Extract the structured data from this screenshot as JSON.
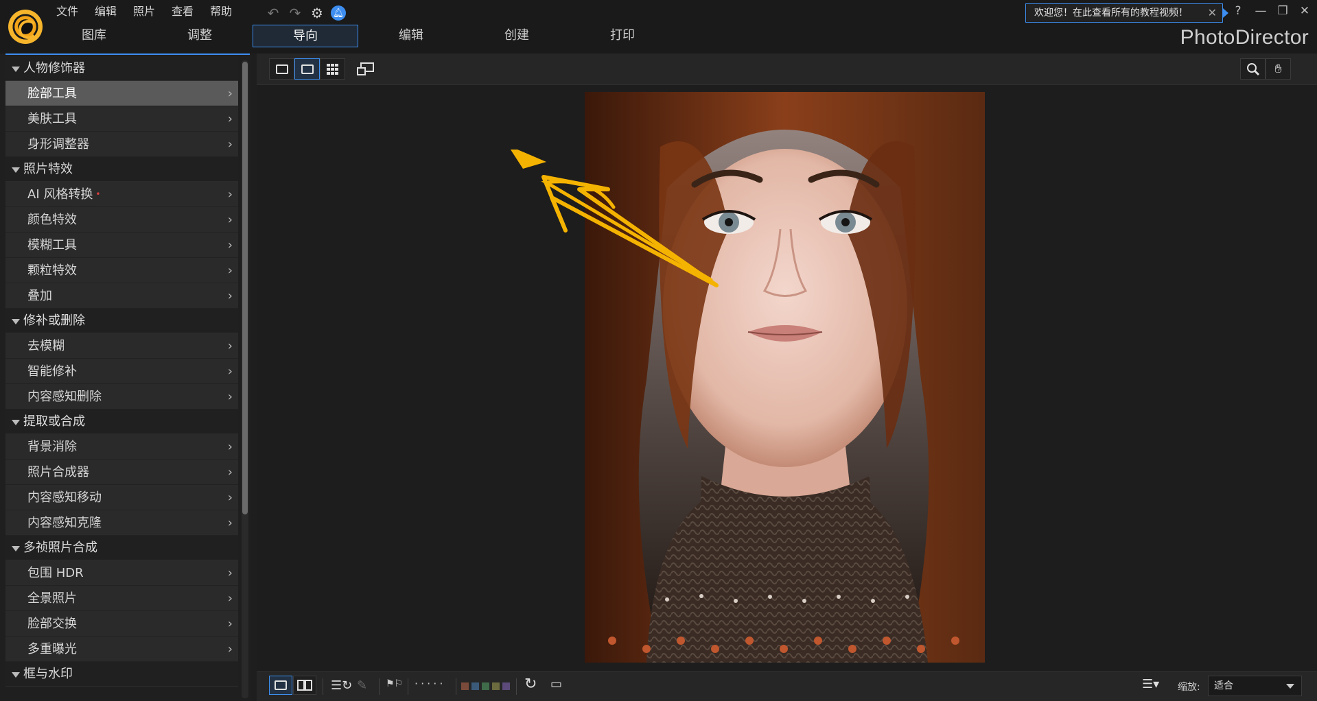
{
  "menu": [
    "文件",
    "编辑",
    "照片",
    "查看",
    "帮助"
  ],
  "tabs": [
    "图库",
    "调整",
    "导向",
    "编辑",
    "创建",
    "打印"
  ],
  "active_tab": "导向",
  "welcome": "欢迎您！在此查看所有的教程视频！",
  "brand": "PhotoDirector",
  "window_help": "?",
  "tree": [
    {
      "label": "人物修饰器",
      "items": [
        {
          "label": "脸部工具",
          "selected": true
        },
        {
          "label": "美肤工具"
        },
        {
          "label": "身形调整器"
        }
      ]
    },
    {
      "label": "照片特效",
      "items": [
        {
          "label": "AI 风格转换",
          "dot": true
        },
        {
          "label": "颜色特效"
        },
        {
          "label": "模糊工具"
        },
        {
          "label": "颗粒特效"
        },
        {
          "label": "叠加"
        }
      ]
    },
    {
      "label": "修补或删除",
      "items": [
        {
          "label": "去模糊"
        },
        {
          "label": "智能修补"
        },
        {
          "label": "内容感知删除"
        }
      ]
    },
    {
      "label": "提取或合成",
      "items": [
        {
          "label": "背景消除"
        },
        {
          "label": "照片合成器"
        },
        {
          "label": "内容感知移动"
        },
        {
          "label": "内容感知克隆"
        }
      ]
    },
    {
      "label": "多祯照片合成",
      "items": [
        {
          "label": "包围 HDR"
        },
        {
          "label": "全景照片"
        },
        {
          "label": "脸部交换"
        },
        {
          "label": "多重曝光"
        }
      ]
    },
    {
      "label": "框与水印",
      "items": []
    }
  ],
  "zoom": {
    "label": "缩放:",
    "value": "适合"
  },
  "colors": {
    "accent": "#3d8ef0",
    "arrow": "#f5b301",
    "swatches": [
      "#7a4b3a",
      "#3b5a7a",
      "#3f6b4a",
      "#6b6b3f",
      "#5b4a7a"
    ]
  }
}
